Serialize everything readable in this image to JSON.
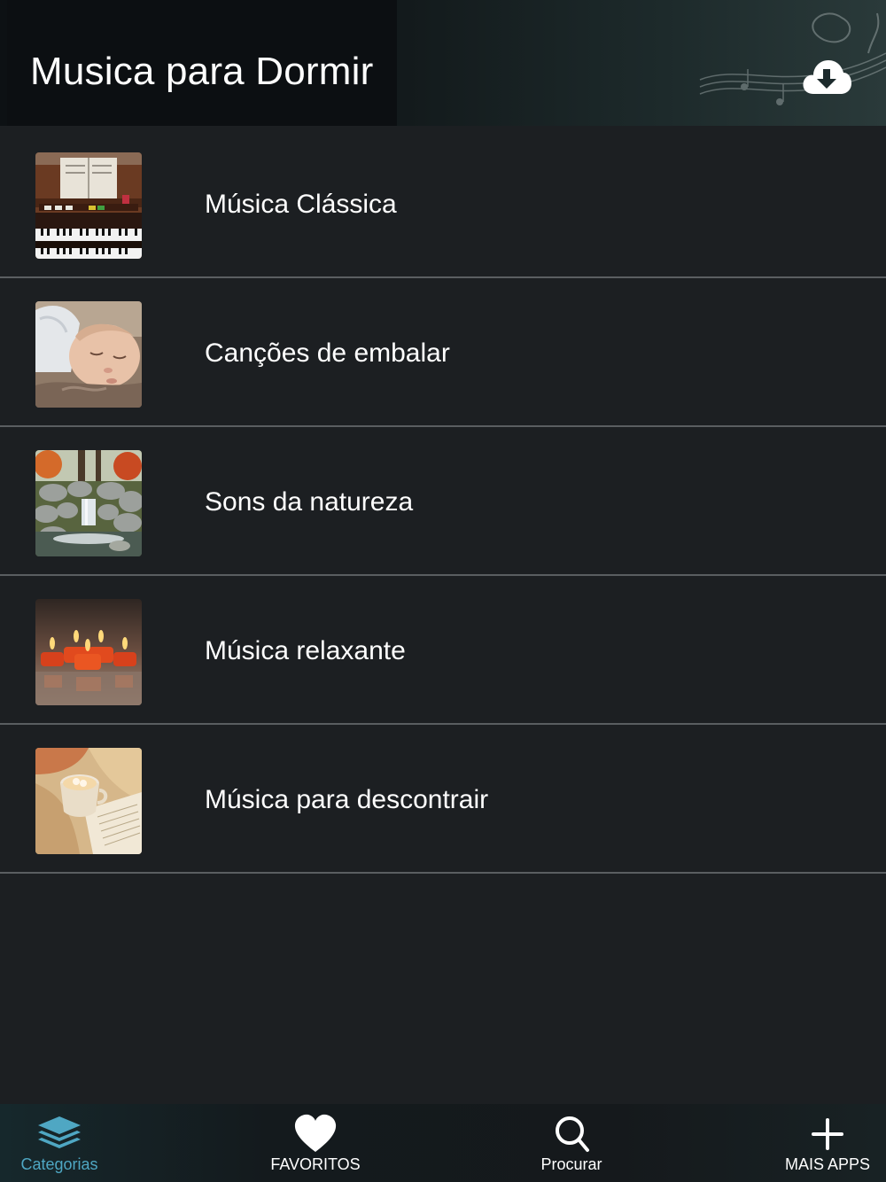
{
  "header": {
    "title": "Musica para Dormir",
    "download_icon": "cloud-download-icon"
  },
  "categories": [
    {
      "label": "Música Clássica",
      "thumb": "piano-organ-image"
    },
    {
      "label": "Canções de embalar",
      "thumb": "sleeping-baby-image"
    },
    {
      "label": "Sons da natureza",
      "thumb": "waterfall-image"
    },
    {
      "label": "Música relaxante",
      "thumb": "candles-image"
    },
    {
      "label": "Música para descontrair",
      "thumb": "tea-blanket-book-image"
    }
  ],
  "tabbar": {
    "tabs": [
      {
        "label": "Categorias",
        "icon": "layers-icon",
        "active": true
      },
      {
        "label": "FAVORITOS",
        "icon": "heart-icon",
        "active": false
      },
      {
        "label": "Procurar",
        "icon": "search-icon",
        "active": false
      },
      {
        "label": "MAIS APPS",
        "icon": "plus-icon",
        "active": false
      }
    ],
    "active_color": "#4fa7c3"
  }
}
